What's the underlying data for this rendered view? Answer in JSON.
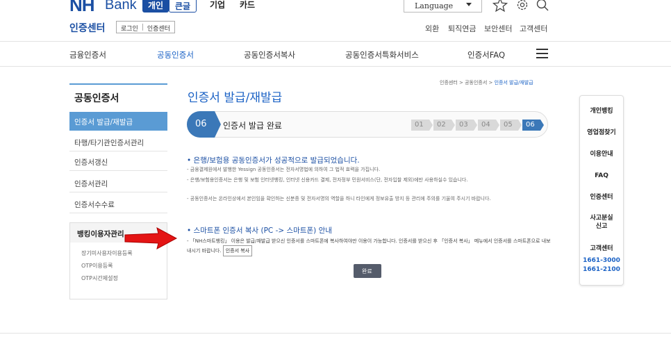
{
  "header": {
    "logo_nh": "NH",
    "logo_bank": "Bank",
    "segments": [
      "개인",
      "큰글"
    ],
    "top_nav": [
      "기업",
      "카드"
    ],
    "language": "Language",
    "icons": [
      "star-icon",
      "gear-icon",
      "search-icon"
    ],
    "cert_center_title": "인증센터",
    "sub_links": [
      "로그인",
      "인증센터"
    ],
    "utils": [
      "외환",
      "퇴직연금",
      "보안센터",
      "고객센터"
    ]
  },
  "gnb": [
    "금융인증서",
    "공동인증서",
    "공동인증서복사",
    "공동인증서특화서비스",
    "인증서FAQ"
  ],
  "lnb": {
    "title": "공동인증서",
    "items": [
      "인증서 발급/재발급",
      "타행/타기관인증서관리",
      "인증서갱신",
      "인증서관리",
      "인증서수수료"
    ],
    "box_title": "뱅킹이용자관리",
    "box_items": [
      "장기미사용자이용등록",
      "OTP이용등록",
      "OTP시간제설정"
    ]
  },
  "breadcrumb": {
    "path": "인증센터 > 공동인증서 > ",
    "current": "인증서 발급/재발급"
  },
  "content": {
    "title": "인증서 발급/재발급",
    "step_number": "06",
    "step_label": "인증서 발급 완료",
    "steps": [
      "01",
      "02",
      "03",
      "04",
      "05",
      "06"
    ],
    "success_heading": "• 은행/보험용 공동인증서가 성공적으로 발급되었습니다.",
    "bullets": [
      "- 금융결제원에서 발행한 Yessign 공동인증서는 전자서명법에 의하여 그 법적 효력을 가집니다.",
      "- 은행/보험용인증서는 은행 및 보험 인터넷뱅킹, 인터넷 신용카드 결제, 전자정부 민원서비스(단, 전자입찰 제외)에만 사용하실수 있습니다.",
      "- 공동인증서는 온라인상에서 본인임을 확인하는 신분증 및 전자서명의 역할을 하니 타인에게 정보유출 방지 등 관리에 주의를 기울여 주시기 바랍니다."
    ],
    "phone_heading": "• 스마트폰 인증서 복사 (PC -> 스마트폰) 안내",
    "phone_text_1": "- 「NH스마트뱅킹」 이용은 발급/재발급 받으신 인증서를 스마트폰에 복사하여야만 이용이 가능합니다. 인증서를 받으신 후 「인증서 복사」 메뉴에서 인증서를 스마트폰으로 내보내시기 바랍니다.",
    "copy_button": "인증서 복사",
    "ok_button": "완료"
  },
  "quick": {
    "items": [
      "개인뱅킹",
      "영업점찾기",
      "이용안내",
      "FAQ",
      "인증센터",
      "사고분실\n신고",
      "고객센터"
    ],
    "phones": [
      "1661-3000",
      "1661-2100"
    ]
  }
}
